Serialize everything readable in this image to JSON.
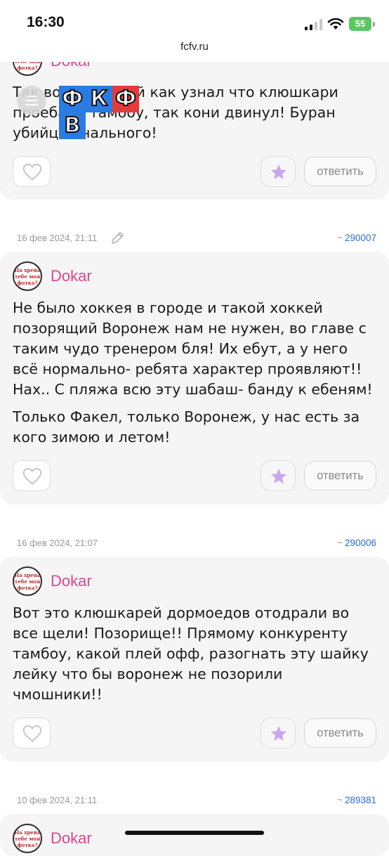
{
  "status": {
    "time": "16:30",
    "battery": "55"
  },
  "browser": {
    "url": "fcfv.ru"
  },
  "site": {
    "logo_letters": [
      "Ф",
      "К",
      "Ф",
      "В"
    ],
    "logo_colors": [
      "#2a7be4",
      "#2a7be4",
      "#e63b3b",
      "#2a7be4"
    ]
  },
  "avatar_text": "На хрена тебе моя фотка?",
  "comments": [
    {
      "author": "Dokar",
      "text": [
        "Так воронежский как узнал что клюшкари проебали тамбоу, так кони двинул! Буран убийца анального!"
      ],
      "reply_label": "ответить"
    },
    {
      "date": "16 фев 2024, 21:11",
      "id": "290007",
      "author": "Dokar",
      "text": [
        "Не было хоккея в городе и такой хоккей позорящий Воронеж нам не нужен, во главе с таким чудо тренером бля! Их ебут, а у него всё нормально- ребята характер проявляют!! Нах.. С пляжа всю эту шабаш- банду к ебеням!",
        "Только Факел, только Воронеж, у нас есть за кого зимою и летом!"
      ],
      "reply_label": "ответить"
    },
    {
      "date": "16 фев 2024, 21:07",
      "id": "290006",
      "author": "Dokar",
      "text": [
        "Вот это клюшкарей дормоедов отодрали во все щели! Позорище!! Прямому конкуренту тамбоу, какой плей офф, разогнать эту шайку лейку что бы воронеж не позорили чмошники!!"
      ],
      "reply_label": "ответить"
    },
    {
      "date": "10 фев 2024, 21:11",
      "id": "289381",
      "author": "Dokar"
    }
  ],
  "colors": {
    "author": "#e2458f",
    "star": "#c9a6ef",
    "link": "#2d6ad6",
    "card_bg": "#f5f5f5"
  }
}
